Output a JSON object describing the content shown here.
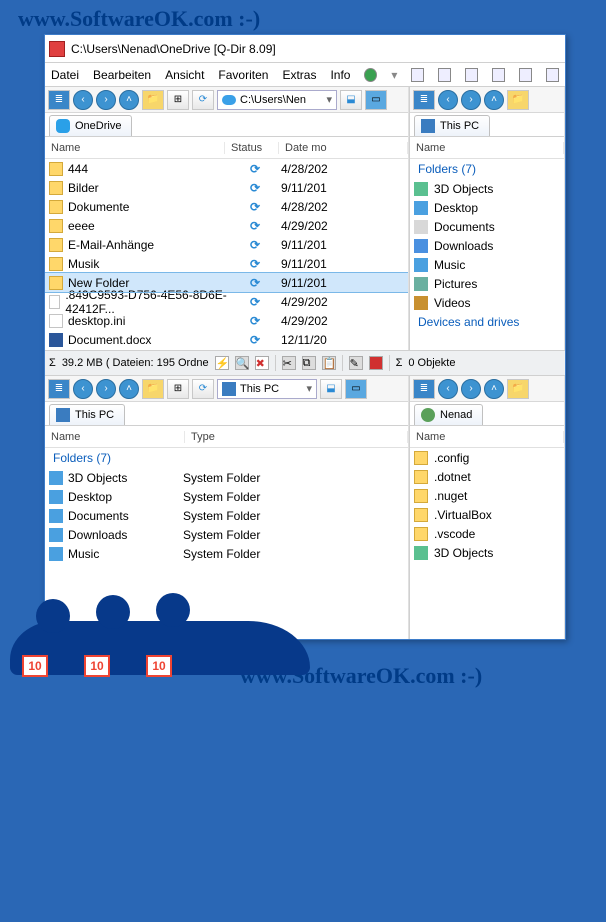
{
  "watermark": "www.SoftwareOK.com :-)",
  "title": "C:\\Users\\Nenad\\OneDrive  [Q-Dir 8.09]",
  "menu": [
    "Datei",
    "Bearbeiten",
    "Ansicht",
    "Favoriten",
    "Extras",
    "Info"
  ],
  "addr_left": "C:\\Users\\Nen",
  "pane_tl": {
    "tab": "OneDrive",
    "cols": [
      "Name",
      "Status",
      "Date mo"
    ],
    "rows": [
      {
        "icon": "folder",
        "name": "444",
        "sync": true,
        "date": "4/28/202"
      },
      {
        "icon": "folder",
        "name": "Bilder",
        "sync": true,
        "date": "9/11/201"
      },
      {
        "icon": "folder",
        "name": "Dokumente",
        "sync": true,
        "date": "4/28/202"
      },
      {
        "icon": "folder",
        "name": "eeee",
        "sync": true,
        "date": "4/29/202"
      },
      {
        "icon": "folder",
        "name": "E-Mail-Anhänge",
        "sync": true,
        "date": "9/11/201"
      },
      {
        "icon": "folder",
        "name": "Musik",
        "sync": true,
        "date": "9/11/201"
      },
      {
        "icon": "folder",
        "name": "New Folder",
        "sync": true,
        "date": "9/11/201",
        "sel": true
      },
      {
        "icon": "file",
        "name": ".849C9593-D756-4E56-8D6E-42412F...",
        "sync": true,
        "date": "4/29/202"
      },
      {
        "icon": "file",
        "name": "desktop.ini",
        "sync": true,
        "date": "4/29/202"
      },
      {
        "icon": "doc",
        "name": "Document.docx",
        "sync": true,
        "date": "12/11/20"
      }
    ]
  },
  "pane_tr": {
    "tab": "This PC",
    "col": "Name",
    "group": "Folders (7)",
    "rows": [
      "3D Objects",
      "Desktop",
      "Documents",
      "Downloads",
      "Music",
      "Pictures",
      "Videos"
    ],
    "group2": "Devices and drives"
  },
  "statusbar": {
    "left": "39.2 MB ( Dateien: 195 Ordne",
    "right": "0 Objekte"
  },
  "pane_bl": {
    "tab": "This PC",
    "addr": "This PC",
    "cols": [
      "Name",
      "Type"
    ],
    "group": "Folders (7)",
    "rows": [
      {
        "name": "3D Objects",
        "type": "System Folder"
      },
      {
        "name": "Desktop",
        "type": "System Folder"
      },
      {
        "name": "Documents",
        "type": "System Folder"
      },
      {
        "name": "Downloads",
        "type": "System Folder"
      },
      {
        "name": "Music",
        "type": "System Folder"
      }
    ]
  },
  "pane_br": {
    "tab": "Nenad",
    "col": "Name",
    "rows": [
      ".config",
      ".dotnet",
      ".nuget",
      ".VirtualBox",
      ".vscode",
      "3D Objects"
    ]
  },
  "mascot_num": "10"
}
